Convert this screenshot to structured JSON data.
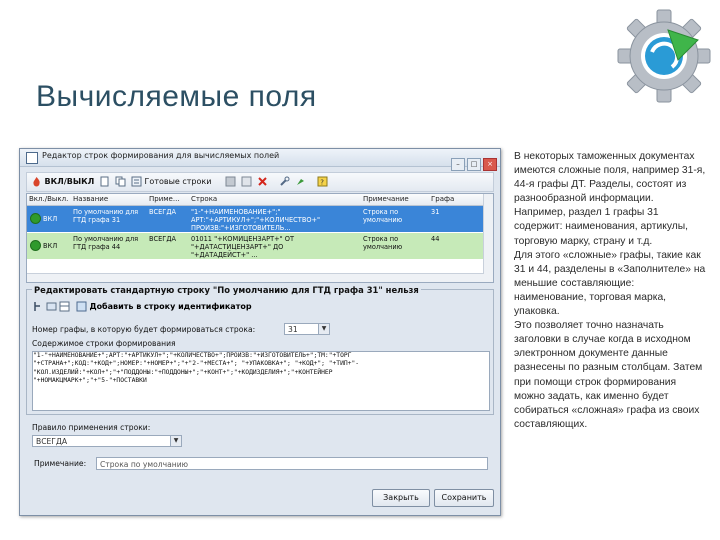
{
  "slide": {
    "title": "Вычисляемые поля",
    "body": [
      "В некоторых таможенных документах имеются сложные поля, например 31-я, 44-я графы ДТ. Разделы, состоят из разнообразной информации. Например, раздел 1 графы 31 содержит: наименования, артикулы, торговую марку, страну и т.д.",
      "Для этого «сложные» графы, такие как 31 и 44, разделены в «Заполнителе» на меньшие составляющие: наименование, торговая марка, упаковка.",
      "Это позволяет точно назначать заголовки в случае когда в исходном электронном документе данные разнесены по разным столбцам. Затем при помощи строк формирования можно задать, как именно будет собираться «сложная» графа из своих составляющих."
    ]
  },
  "window": {
    "title": "Редактор строк формирования для вычисляемых полей",
    "toolbar": {
      "onoff_label": "ВКЛ/ВЫКЛ",
      "ready_label": "Готовые строки"
    },
    "grid": {
      "columns": [
        "Вкл./Выкл.",
        "Название",
        "Приме...",
        "Строка",
        "Примечание",
        "Графа"
      ],
      "rows": [
        {
          "state": "ВКЛ",
          "name": "По умолчанию для\nГТД графа 31",
          "apply": "ВСЕГДА",
          "line": "\"1-\"+НАИМЕНОВАНИЕ+\";\"\nАРТ:\"+АРТИКУЛ+\";\"+КОЛИЧЕСТВО+\"\nПРОИЗВ:\"+ИЗГОТОВИТЕЛЬ...",
          "note": "Строка по\nумолчанию",
          "column": "31"
        },
        {
          "state": "ВКЛ",
          "name": "По умолчанию для\nГТД графа 44",
          "apply": "ВСЕГДА",
          "line": "01011 \"+КОМИЦЕНЗАРТ+\" ОТ\n\"+ДАТАСТИЦЕНЗАРТ+\" ДО\n\"+ДАТАДЕЙСТ+\" ...",
          "note": "Строка по\nумолчанию",
          "column": "44"
        }
      ]
    },
    "editor": {
      "group_label": "Редактировать стандартную строку \"По умолчанию для ГТД графа 31\" нельзя",
      "add_id_label": "Добавить в строку идентификатор",
      "column_label": "Номер графы, в которую будет формироваться строка:",
      "column_value": "31",
      "content_label": "Содержимое строки формирования",
      "formula": "\"1-\"+НАИМЕНОВАНИЕ+\";АРТ:\"+АРТИКУЛ+\";\"+КОЛИЧЕСТВО+\";ПРОИЗВ:\"+ИЗГОТОВИТЕЛЬ+\";ТМ:\"+ТОРГ\n\"+СТРАНА+\";КОД:\"+КОД+\";НОМЕР:\"+НОМЕР+\";\"+\"2-\"+МЕСТА+\"; \"+УПАКОВКА+\"; \"+КОД+\"; \"+ТИП+\"-\n\"КОЛ.ИЗДЕЛИЙ:\"+КОЛ+\";\"+\"ПОДДОНЫ:\"+ПОДДОНЫ+\";\"+КОНТ+\";\"+КОДИЗДЕЛИЯ+\";\"+КОНТЕЙНЕР\n\"+НОМАКЦМАРК+\";\"+\"5-\"+ПОСТАВКИ\n",
      "apply_rule_label": "Правило применения строки:",
      "apply_rule_value": "ВСЕГДА",
      "note_label": "Примечание:",
      "note_value": "Строка по умолчанию"
    },
    "buttons": {
      "close": "Закрыть",
      "save": "Сохранить"
    }
  }
}
